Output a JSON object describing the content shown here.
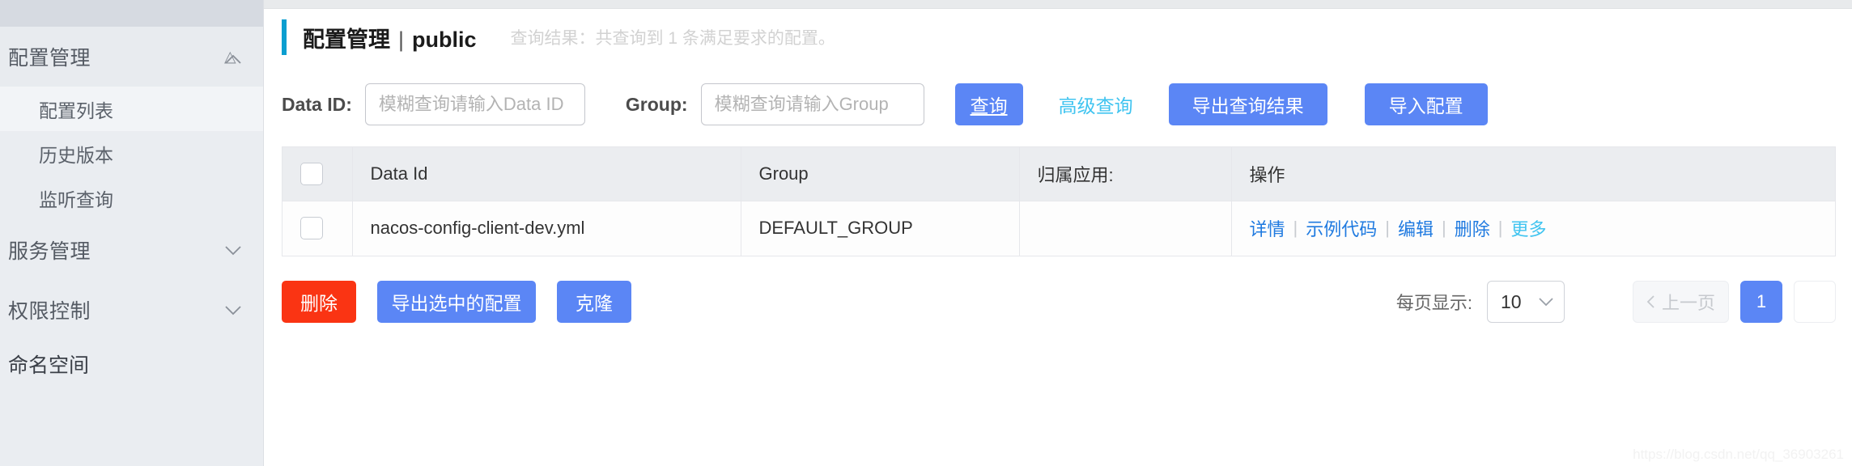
{
  "sidebar": {
    "groups": [
      {
        "label": "配置管理",
        "icon": "chevron-up-icon",
        "expanded": true,
        "items": [
          {
            "label": "配置列表",
            "active": true
          },
          {
            "label": "历史版本",
            "active": false
          },
          {
            "label": "监听查询",
            "active": false
          }
        ]
      },
      {
        "label": "服务管理",
        "icon": "chevron-down-icon",
        "expanded": false,
        "items": []
      },
      {
        "label": "权限控制",
        "icon": "chevron-down-icon",
        "expanded": false,
        "items": []
      }
    ],
    "bottom_item": {
      "label": "命名空间"
    }
  },
  "header": {
    "title": "配置管理",
    "separator": "|",
    "namespace": "public",
    "query_result": "查询结果：共查询到 1 条满足要求的配置。",
    "accent_color": "#0a9ed0"
  },
  "search": {
    "dataid_label": "Data ID:",
    "dataid_placeholder": "模糊查询请输入Data ID",
    "dataid_value": "",
    "group_label": "Group:",
    "group_placeholder": "模糊查询请输入Group",
    "group_value": "",
    "query_button": "查询",
    "advanced_link": "高级查询",
    "export_button": "导出查询结果",
    "import_button": "导入配置",
    "primary_color": "#5b86f5",
    "link_color": "#40c4f0"
  },
  "table": {
    "columns": [
      "Data Id",
      "Group",
      "归属应用:",
      "操作"
    ],
    "rows": [
      {
        "checked": false,
        "data_id": "nacos-config-client-dev.yml",
        "group": "DEFAULT_GROUP",
        "app": "",
        "actions": [
          "详情",
          "示例代码",
          "编辑",
          "删除",
          "更多"
        ],
        "action_divider": "|"
      }
    ]
  },
  "footer": {
    "delete_button": "删除",
    "export_selected_button": "导出选中的配置",
    "clone_button": "克隆",
    "delete_color": "#fa3413",
    "page_size_label": "每页显示:",
    "page_size_value": "10",
    "page_size_icon": "chevron-down-icon",
    "prev_page_label": "上一页",
    "prev_page_icon": "chevron-left-icon",
    "current_page": "1"
  },
  "watermark": "https://blog.csdn.net/qq_36903261"
}
